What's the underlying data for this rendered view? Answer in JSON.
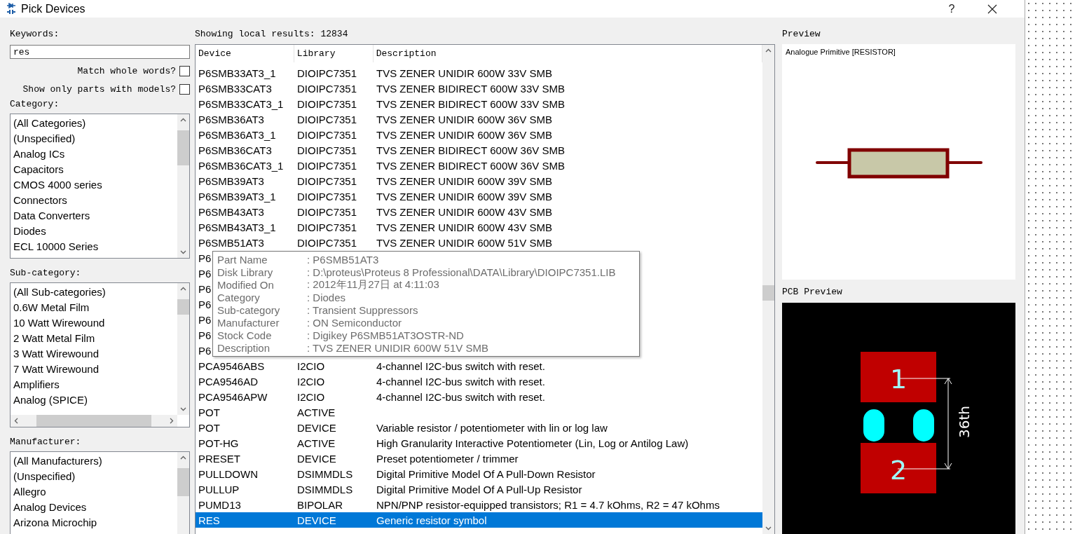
{
  "window": {
    "title": "Pick Devices",
    "help": "?"
  },
  "keywords": {
    "label": "Keywords:",
    "value": "res"
  },
  "options": [
    {
      "label": "Match whole words?",
      "checked": false
    },
    {
      "label": "Show only parts with models?",
      "checked": false
    }
  ],
  "category": {
    "label": "Category:",
    "items": [
      {
        "label": "(All Categories)",
        "selected": false
      },
      {
        "label": "(Unspecified)",
        "selected": false
      },
      {
        "label": "Analog ICs",
        "selected": false
      },
      {
        "label": "Capacitors",
        "selected": false
      },
      {
        "label": "CMOS 4000 series",
        "selected": false
      },
      {
        "label": "Connectors",
        "selected": false
      },
      {
        "label": "Data Converters",
        "selected": false
      },
      {
        "label": "Diodes",
        "selected": false
      },
      {
        "label": "ECL 10000 Series",
        "selected": false
      }
    ]
  },
  "sub_category": {
    "label": "Sub-category:",
    "items": [
      {
        "label": "(All Sub-categories)",
        "selected": false
      },
      {
        "label": "0.6W Metal Film",
        "selected": false
      },
      {
        "label": "10 Watt Wirewound",
        "selected": false
      },
      {
        "label": "2 Watt Metal Film",
        "selected": false
      },
      {
        "label": "3 Watt Wirewound",
        "selected": false
      },
      {
        "label": "7 Watt Wirewound",
        "selected": false
      },
      {
        "label": "Amplifiers",
        "selected": false
      },
      {
        "label": "Analog (SPICE)",
        "selected": false
      }
    ]
  },
  "manufacturer": {
    "label": "Manufacturer:",
    "items": [
      {
        "label": "(All Manufacturers)",
        "selected": false
      },
      {
        "label": "(Unspecified)",
        "selected": false
      },
      {
        "label": "Allegro",
        "selected": false
      },
      {
        "label": "Analog Devices",
        "selected": false
      },
      {
        "label": "Arizona Microchip",
        "selected": false
      }
    ]
  },
  "results": {
    "label": "Showing local results: 12834",
    "columns": [
      "Device",
      "Library",
      "Description"
    ],
    "rows": [
      {
        "device": "P6SMB33AT3_1",
        "library": "DIOIPC7351",
        "description": "TVS ZENER UNIDIR 600W 33V SMB",
        "selected": false
      },
      {
        "device": "P6SMB33CAT3",
        "library": "DIOIPC7351",
        "description": "TVS ZENER BIDIRECT 600W 33V SMB",
        "selected": false
      },
      {
        "device": "P6SMB33CAT3_1",
        "library": "DIOIPC7351",
        "description": "TVS ZENER BIDIRECT 600W 33V SMB",
        "selected": false
      },
      {
        "device": "P6SMB36AT3",
        "library": "DIOIPC7351",
        "description": "TVS ZENER UNIDIR 600W 36V SMB",
        "selected": false
      },
      {
        "device": "P6SMB36AT3_1",
        "library": "DIOIPC7351",
        "description": "TVS ZENER UNIDIR 600W 36V SMB",
        "selected": false
      },
      {
        "device": "P6SMB36CAT3",
        "library": "DIOIPC7351",
        "description": "TVS ZENER BIDIRECT 600W 36V SMB",
        "selected": false
      },
      {
        "device": "P6SMB36CAT3_1",
        "library": "DIOIPC7351",
        "description": "TVS ZENER BIDIRECT 600W 36V SMB",
        "selected": false
      },
      {
        "device": "P6SMB39AT3",
        "library": "DIOIPC7351",
        "description": "TVS ZENER UNIDIR 600W 39V SMB",
        "selected": false
      },
      {
        "device": "P6SMB39AT3_1",
        "library": "DIOIPC7351",
        "description": "TVS ZENER UNIDIR 600W 39V SMB",
        "selected": false
      },
      {
        "device": "P6SMB43AT3",
        "library": "DIOIPC7351",
        "description": "TVS ZENER UNIDIR 600W 43V SMB",
        "selected": false
      },
      {
        "device": "P6SMB43AT3_1",
        "library": "DIOIPC7351",
        "description": "TVS ZENER UNIDIR 600W 43V SMB",
        "selected": false
      },
      {
        "device": "P6SMB51AT3",
        "library": "DIOIPC7351",
        "description": "TVS ZENER UNIDIR 600W 51V SMB",
        "selected": false
      },
      {
        "device": "P6",
        "selected": false
      },
      {
        "device": "P6",
        "selected": false
      },
      {
        "device": "P6",
        "selected": false
      },
      {
        "device": "P6",
        "selected": false
      },
      {
        "device": "P6",
        "selected": false
      },
      {
        "device": "P6",
        "selected": false
      },
      {
        "device": "P6",
        "selected": false
      },
      {
        "device": "PCA9546ABS",
        "library": "I2CIO",
        "description": "4-channel I2C-bus switch with reset.",
        "selected": false
      },
      {
        "device": "PCA9546AD",
        "library": "I2CIO",
        "description": "4-channel I2C-bus switch with reset.",
        "selected": false
      },
      {
        "device": "PCA9546APW",
        "library": "I2CIO",
        "description": "4-channel I2C-bus switch with reset.",
        "selected": false
      },
      {
        "device": "POT",
        "library": "ACTIVE",
        "selected": false
      },
      {
        "device": "POT",
        "library": "DEVICE",
        "description": "Variable resistor / potentiometer with lin or log law",
        "selected": false
      },
      {
        "device": "POT-HG",
        "library": "ACTIVE",
        "description": "High Granularity Interactive Potentiometer (Lin, Log or Antilog Law)",
        "selected": false
      },
      {
        "device": "PRESET",
        "library": "DEVICE",
        "description": "Preset potentiometer / trimmer",
        "selected": false
      },
      {
        "device": "PULLDOWN",
        "library": "DSIMMDLS",
        "description": "Digital Primitive Model Of A Pull-Down Resistor",
        "selected": false
      },
      {
        "device": "PULLUP",
        "library": "DSIMMDLS",
        "description": "Digital Primitive Model Of A Pull-Up Resistor",
        "selected": false
      },
      {
        "device": "PUMD13",
        "library": "BIPOLAR",
        "description": "NPN/PNP resistor-equipped transistors; R1 = 4.7 kOhms, R2 = 47 kOhms",
        "selected": false
      },
      {
        "device": "RES",
        "library": "DEVICE",
        "description": "Generic resistor symbol",
        "selected": true
      }
    ]
  },
  "tooltip": {
    "fields": [
      {
        "name": "Part Name",
        "value": ": P6SMB51AT3"
      },
      {
        "name": "Disk Library",
        "value": ": D:\\proteus\\Proteus 8 Professional\\DATA\\Library\\DIOIPC7351.LIB"
      },
      {
        "name": "Modified On",
        "value": ": 2012年11月27日 at 4:11:03"
      },
      {
        "name": "Category",
        "value": ": Diodes"
      },
      {
        "name": "Sub-category",
        "value": ": Transient Suppressors"
      },
      {
        "name": "Manufacturer",
        "value": ": ON Semiconductor"
      },
      {
        "name": "Stock Code",
        "value": ": Digikey P6SMB51AT3OSTR-ND"
      },
      {
        "name": "Description",
        "value": ": TVS ZENER UNIDIR 600W 51V SMB"
      }
    ]
  },
  "preview": {
    "label": "Preview",
    "caption": "Analogue Primitive [RESISTOR]"
  },
  "pcb_preview": {
    "label": "PCB Preview",
    "pads": [
      "1",
      "2"
    ],
    "dimension": "36th"
  }
}
